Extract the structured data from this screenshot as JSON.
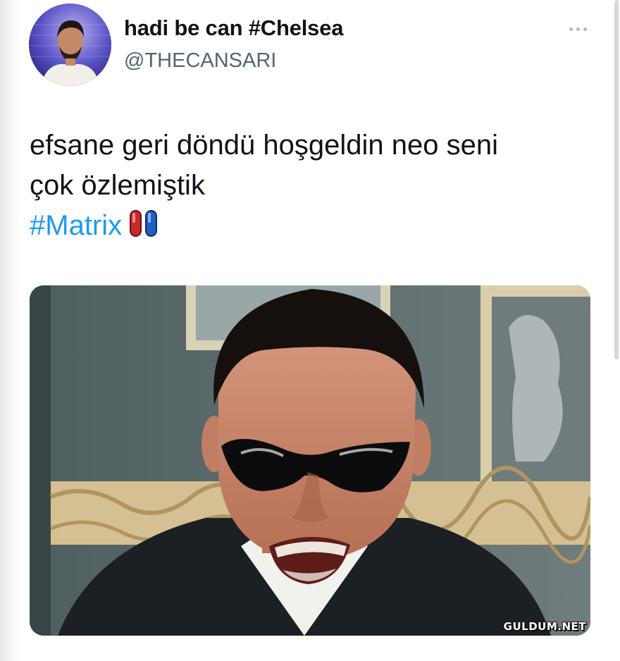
{
  "tweet": {
    "display_name": "hadi be can #Chelsea",
    "handle": "@THECANSARI",
    "text_line1": "efsane geri döndü hoşgeldin neo seni",
    "text_line2": "çok özlemiştik",
    "hashtag": "#Matrix",
    "emoji": "pill-icon",
    "more_icon": "more-horizontal-icon",
    "hashtag_color": "#1d9bf0"
  },
  "watermark": "GULDUM.NET"
}
